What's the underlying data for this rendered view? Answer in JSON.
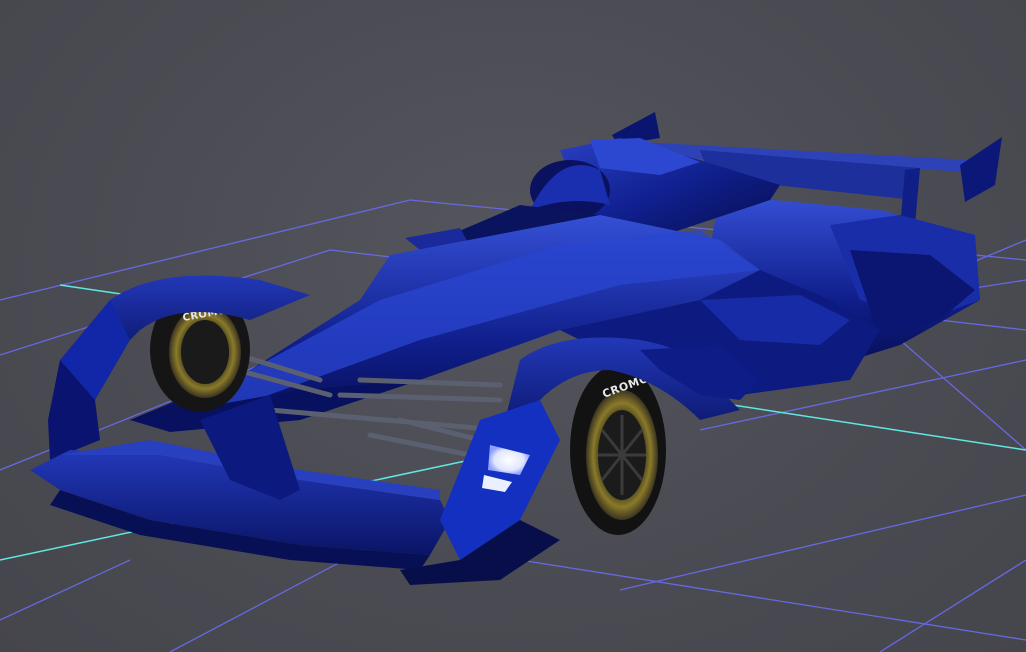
{
  "viewport": {
    "background_color": "#4a4a52",
    "grid_color": "#6a6cf0",
    "axis_color": "#5fe8e0"
  },
  "car": {
    "body_color": "#0d1a8c",
    "highlight_color": "#2b45c9",
    "shadow_color": "#050a3d",
    "tire_color": "#141414",
    "rim_color": "#8a7a2a",
    "front_tire_label": "CROMO",
    "left_tire_label": "CROMO"
  },
  "icons": {
    "headlight": "headlight-icon"
  }
}
